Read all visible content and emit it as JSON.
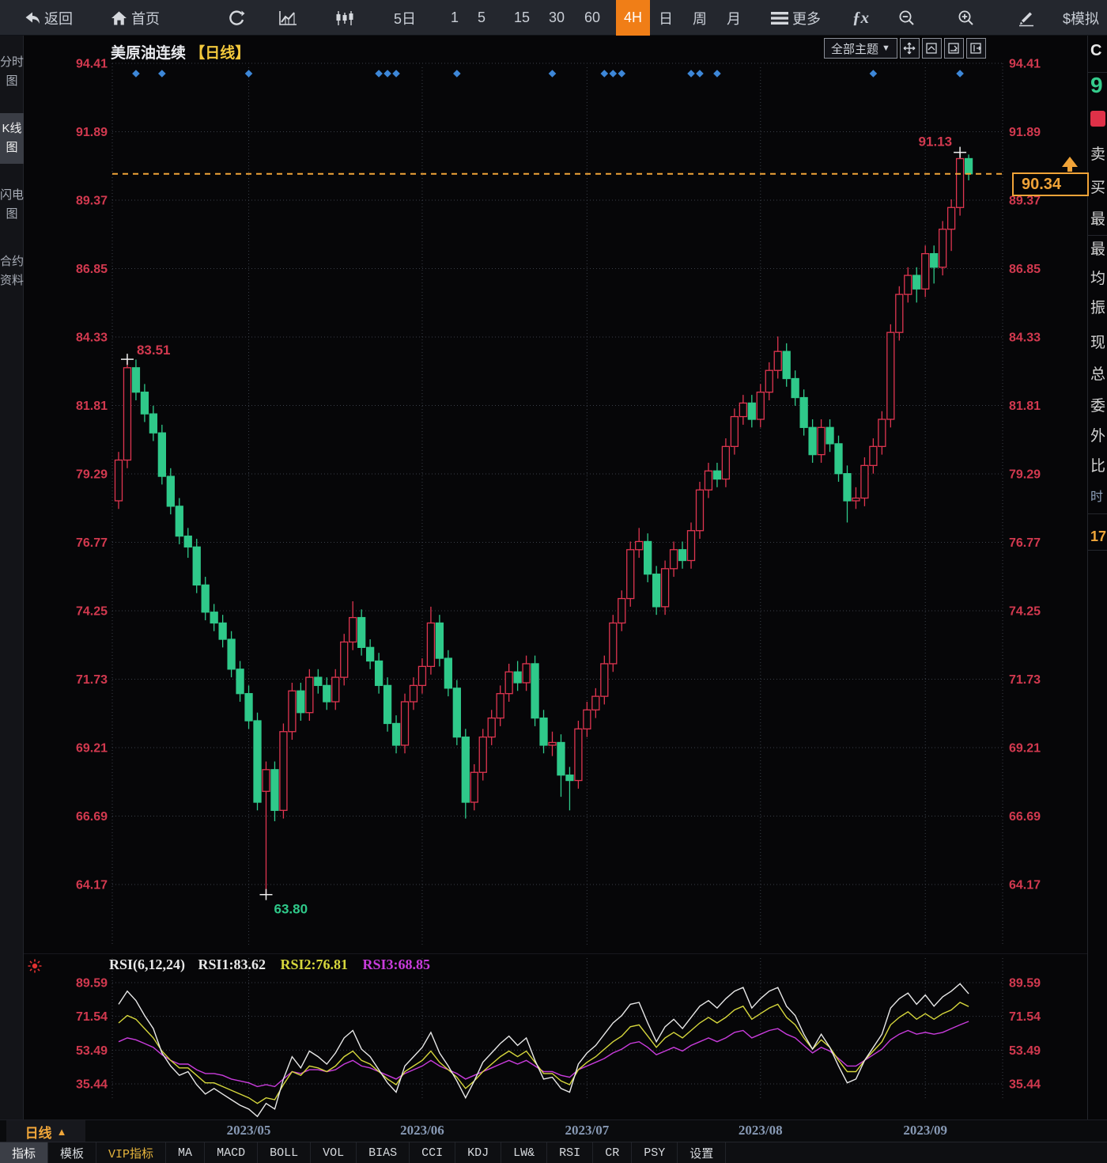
{
  "toolbar": {
    "items": [
      {
        "name": "back",
        "label": "返回",
        "icon": "back"
      },
      {
        "name": "home",
        "label": "首页",
        "icon": "home"
      },
      {
        "name": "refresh",
        "icon": "refresh"
      },
      {
        "name": "chart-line",
        "icon": "chartLine"
      },
      {
        "name": "chart-candle",
        "icon": "chartCandle"
      },
      {
        "name": "period-5d",
        "label": "5日"
      },
      {
        "name": "period-1",
        "label": "1"
      },
      {
        "name": "period-5",
        "label": "5"
      },
      {
        "name": "period-15",
        "label": "15"
      },
      {
        "name": "period-30",
        "label": "30"
      },
      {
        "name": "period-60",
        "label": "60"
      },
      {
        "name": "period-4h",
        "label": "4H",
        "active": true
      },
      {
        "name": "period-day",
        "label": "日"
      },
      {
        "name": "period-week",
        "label": "周"
      },
      {
        "name": "period-month",
        "label": "月"
      },
      {
        "name": "more",
        "label": "更多",
        "icon": "menu"
      },
      {
        "name": "fx",
        "label": "ƒx",
        "fx": true
      },
      {
        "name": "zoom-out",
        "icon": "zoomOut"
      },
      {
        "name": "zoom-in",
        "icon": "zoomIn"
      },
      {
        "name": "draw",
        "icon": "pencil"
      },
      {
        "name": "sim-trade",
        "label": "$模拟"
      }
    ]
  },
  "sidebar": {
    "tabs": [
      {
        "name": "tab-time-chart",
        "label": "分时图",
        "active": false
      },
      {
        "name": "tab-kline-chart",
        "label": "K线图",
        "active": true
      },
      {
        "name": "tab-flash-chart",
        "label": "闪电图",
        "active": false
      },
      {
        "name": "tab-contract-info",
        "label": "合约资料",
        "active": false
      }
    ]
  },
  "chart": {
    "title": "美原油连续",
    "title_suffix": "【日线】",
    "theme_button_label": "全部主题",
    "theme_button_arrow": "▼",
    "current_price": "90.34",
    "annotations": {
      "first_high": "83.51",
      "low": "63.80",
      "high": "91.13"
    },
    "y_axis_labels": [
      "94.41",
      "91.89",
      "89.37",
      "86.85",
      "84.33",
      "81.81",
      "79.29",
      "76.77",
      "74.25",
      "71.73",
      "69.21",
      "66.69",
      "64.17"
    ],
    "price_axis_max": 94.41,
    "price_axis_min": 64.17,
    "month_ticks": [
      {
        "index": 15,
        "label": "2023/05"
      },
      {
        "index": 35,
        "label": "2023/06"
      },
      {
        "index": 54,
        "label": "2023/07"
      },
      {
        "index": 74,
        "label": "2023/08"
      },
      {
        "index": 93,
        "label": "2023/09"
      }
    ],
    "event_dot_indices": [
      2,
      5,
      15,
      30,
      31,
      32,
      39,
      50,
      56,
      57,
      58,
      66,
      67,
      69,
      87,
      97
    ],
    "chart_data": {
      "type": "candlestick",
      "ohlc": [
        [
          78.3,
          80.1,
          78.0,
          79.8
        ],
        [
          79.8,
          83.51,
          79.5,
          83.2
        ],
        [
          83.2,
          83.5,
          82.0,
          82.3
        ],
        [
          82.3,
          82.6,
          81.2,
          81.5
        ],
        [
          81.5,
          81.8,
          80.5,
          80.8
        ],
        [
          80.8,
          81.1,
          78.9,
          79.2
        ],
        [
          79.2,
          79.5,
          77.8,
          78.1
        ],
        [
          78.1,
          78.4,
          76.7,
          77.0
        ],
        [
          77.0,
          77.3,
          76.2,
          76.6
        ],
        [
          76.6,
          76.9,
          74.9,
          75.2
        ],
        [
          75.2,
          75.5,
          73.9,
          74.2
        ],
        [
          74.2,
          74.5,
          73.5,
          73.8
        ],
        [
          73.8,
          74.1,
          72.9,
          73.2
        ],
        [
          73.2,
          73.5,
          71.8,
          72.1
        ],
        [
          72.1,
          72.4,
          70.9,
          71.2
        ],
        [
          71.2,
          71.5,
          69.9,
          70.2
        ],
        [
          70.2,
          70.5,
          66.9,
          67.2
        ],
        [
          67.6,
          68.7,
          63.8,
          68.4
        ],
        [
          68.4,
          68.7,
          66.5,
          66.9
        ],
        [
          66.9,
          70.1,
          66.6,
          69.8
        ],
        [
          69.8,
          71.6,
          69.5,
          71.3
        ],
        [
          71.3,
          71.6,
          70.2,
          70.5
        ],
        [
          70.5,
          72.1,
          70.2,
          71.8
        ],
        [
          71.8,
          72.1,
          71.2,
          71.5
        ],
        [
          71.5,
          71.8,
          70.6,
          70.9
        ],
        [
          70.9,
          72.1,
          70.6,
          71.8
        ],
        [
          71.8,
          73.4,
          71.5,
          73.1
        ],
        [
          73.1,
          74.6,
          72.8,
          74.0
        ],
        [
          74.0,
          74.3,
          72.6,
          72.9
        ],
        [
          72.9,
          73.2,
          72.1,
          72.4
        ],
        [
          72.4,
          72.7,
          71.2,
          71.5
        ],
        [
          71.5,
          71.8,
          69.8,
          70.1
        ],
        [
          70.1,
          70.4,
          69.0,
          69.3
        ],
        [
          69.3,
          71.2,
          69.0,
          70.9
        ],
        [
          70.9,
          71.8,
          70.6,
          71.5
        ],
        [
          71.5,
          72.5,
          71.2,
          72.2
        ],
        [
          72.2,
          74.4,
          71.9,
          73.8
        ],
        [
          73.8,
          74.1,
          72.2,
          72.5
        ],
        [
          72.5,
          72.8,
          71.1,
          71.4
        ],
        [
          71.4,
          71.7,
          69.3,
          69.6
        ],
        [
          69.6,
          69.9,
          66.6,
          67.2
        ],
        [
          67.2,
          68.6,
          66.9,
          68.3
        ],
        [
          68.3,
          69.9,
          68.0,
          69.6
        ],
        [
          69.6,
          70.6,
          69.3,
          70.3
        ],
        [
          70.3,
          71.5,
          70.0,
          71.2
        ],
        [
          71.2,
          72.3,
          70.9,
          72.0
        ],
        [
          72.0,
          72.4,
          71.3,
          71.6
        ],
        [
          71.6,
          72.6,
          71.3,
          72.3
        ],
        [
          72.3,
          72.6,
          70.0,
          70.3
        ],
        [
          70.3,
          70.6,
          69.0,
          69.3
        ],
        [
          69.3,
          69.8,
          68.9,
          69.4
        ],
        [
          69.4,
          69.7,
          67.4,
          68.2
        ],
        [
          68.2,
          68.5,
          66.9,
          68.0
        ],
        [
          68.0,
          70.2,
          67.7,
          69.9
        ],
        [
          69.9,
          70.9,
          69.6,
          70.6
        ],
        [
          70.6,
          71.4,
          70.3,
          71.1
        ],
        [
          71.1,
          72.6,
          70.8,
          72.3
        ],
        [
          72.3,
          74.1,
          72.0,
          73.8
        ],
        [
          73.8,
          75.0,
          73.5,
          74.7
        ],
        [
          74.7,
          76.8,
          74.4,
          76.5
        ],
        [
          76.5,
          77.3,
          76.2,
          76.8
        ],
        [
          76.8,
          77.1,
          75.3,
          75.6
        ],
        [
          75.6,
          75.9,
          74.1,
          74.4
        ],
        [
          74.4,
          76.1,
          74.1,
          75.8
        ],
        [
          75.8,
          76.8,
          75.5,
          76.5
        ],
        [
          76.5,
          76.8,
          75.8,
          76.1
        ],
        [
          76.1,
          77.5,
          75.8,
          77.2
        ],
        [
          77.2,
          79.0,
          76.9,
          78.7
        ],
        [
          78.7,
          79.7,
          78.4,
          79.4
        ],
        [
          79.4,
          79.7,
          78.8,
          79.1
        ],
        [
          79.1,
          80.6,
          78.8,
          80.3
        ],
        [
          80.3,
          81.7,
          80.0,
          81.4
        ],
        [
          81.4,
          82.2,
          81.1,
          81.9
        ],
        [
          81.9,
          82.2,
          81.0,
          81.3
        ],
        [
          81.3,
          82.6,
          81.0,
          82.3
        ],
        [
          82.3,
          83.4,
          82.0,
          83.1
        ],
        [
          83.1,
          84.35,
          82.8,
          83.8
        ],
        [
          83.8,
          84.1,
          82.5,
          82.8
        ],
        [
          82.8,
          83.1,
          81.8,
          82.1
        ],
        [
          82.1,
          82.4,
          80.7,
          81.0
        ],
        [
          81.0,
          81.3,
          79.7,
          80.0
        ],
        [
          80.0,
          81.3,
          79.7,
          81.0
        ],
        [
          81.0,
          81.3,
          80.1,
          80.4
        ],
        [
          80.4,
          80.7,
          79.0,
          79.3
        ],
        [
          79.3,
          79.6,
          77.5,
          78.3
        ],
        [
          78.3,
          78.8,
          78.0,
          78.4
        ],
        [
          78.4,
          79.9,
          78.1,
          79.6
        ],
        [
          79.6,
          80.6,
          79.3,
          80.3
        ],
        [
          80.3,
          81.6,
          80.0,
          81.3
        ],
        [
          81.3,
          84.8,
          81.0,
          84.5
        ],
        [
          84.5,
          86.2,
          84.2,
          85.9
        ],
        [
          85.9,
          86.9,
          85.6,
          86.6
        ],
        [
          86.6,
          86.9,
          85.6,
          86.1
        ],
        [
          86.1,
          87.7,
          85.8,
          87.4
        ],
        [
          87.4,
          87.7,
          86.3,
          86.9
        ],
        [
          86.9,
          88.6,
          86.6,
          88.3
        ],
        [
          88.3,
          89.4,
          87.5,
          89.1
        ],
        [
          89.1,
          91.13,
          88.8,
          90.9
        ],
        [
          90.9,
          91.05,
          90.1,
          90.34
        ]
      ]
    }
  },
  "rsi": {
    "param_label": "RSI(6,12,24)",
    "rsi1_label": "RSI1:83.62",
    "rsi2_label": "RSI2:76.81",
    "rsi3_label": "RSI3:68.85",
    "y_axis_labels": [
      "89.59",
      "71.54",
      "53.49",
      "35.44"
    ],
    "axis_max": 89.59,
    "axis_min": 35.44,
    "chart_data": {
      "type": "line",
      "series": [
        {
          "name": "RSI1",
          "color": "#e8e8e8",
          "values": [
            78,
            85,
            80,
            72,
            65,
            52,
            45,
            40,
            42,
            35,
            30,
            33,
            30,
            27,
            24,
            22,
            18,
            25,
            22,
            38,
            50,
            44,
            53,
            50,
            46,
            52,
            60,
            64,
            54,
            50,
            43,
            36,
            31,
            45,
            50,
            55,
            63,
            52,
            45,
            37,
            28,
            37,
            47,
            52,
            57,
            61,
            56,
            60,
            48,
            38,
            39,
            33,
            31,
            46,
            52,
            56,
            62,
            68,
            72,
            78,
            79,
            68,
            58,
            66,
            70,
            65,
            71,
            77,
            80,
            76,
            81,
            85,
            87,
            76,
            81,
            85,
            87,
            77,
            72,
            62,
            54,
            62,
            55,
            45,
            36,
            38,
            48,
            55,
            62,
            76,
            81,
            84,
            78,
            83,
            77,
            82,
            85,
            89,
            83.62
          ]
        },
        {
          "name": "RSI2",
          "color": "#d6d73c",
          "values": [
            68,
            72,
            70,
            65,
            60,
            53,
            48,
            44,
            44,
            40,
            36,
            36,
            34,
            32,
            30,
            28,
            25,
            28,
            27,
            35,
            42,
            40,
            45,
            44,
            42,
            45,
            50,
            53,
            48,
            46,
            42,
            38,
            35,
            42,
            45,
            48,
            53,
            47,
            43,
            39,
            33,
            37,
            42,
            46,
            50,
            53,
            50,
            53,
            47,
            41,
            41,
            37,
            35,
            43,
            47,
            50,
            54,
            58,
            61,
            66,
            67,
            61,
            55,
            60,
            63,
            60,
            64,
            68,
            71,
            68,
            71,
            75,
            77,
            70,
            73,
            76,
            78,
            71,
            67,
            60,
            54,
            59,
            55,
            48,
            42,
            42,
            48,
            53,
            58,
            67,
            71,
            74,
            70,
            73,
            70,
            73,
            75,
            79,
            76.81
          ]
        },
        {
          "name": "RSI3",
          "color": "#c93cdc",
          "values": [
            58,
            60,
            59,
            57,
            55,
            51,
            48,
            46,
            46,
            43,
            41,
            41,
            40,
            38,
            37,
            36,
            34,
            35,
            34,
            38,
            42,
            41,
            43,
            43,
            42,
            43,
            46,
            48,
            45,
            44,
            42,
            40,
            38,
            41,
            43,
            45,
            48,
            45,
            43,
            41,
            38,
            40,
            42,
            44,
            46,
            48,
            46,
            48,
            45,
            42,
            42,
            40,
            39,
            43,
            45,
            47,
            49,
            52,
            54,
            57,
            58,
            55,
            51,
            53,
            55,
            53,
            56,
            58,
            60,
            58,
            60,
            63,
            64,
            60,
            62,
            64,
            65,
            62,
            60,
            56,
            52,
            55,
            53,
            49,
            45,
            45,
            48,
            51,
            54,
            59,
            62,
            64,
            62,
            63,
            62,
            63,
            65,
            67,
            68.85
          ]
        }
      ]
    }
  },
  "x_axis": {
    "period_label": "日线",
    "period_arrow": "▲"
  },
  "bottom_tabs": [
    {
      "name": "tab-indicator",
      "label": "指标",
      "active": true
    },
    {
      "name": "tab-template",
      "label": "模板"
    },
    {
      "name": "tab-vip-indicator",
      "label": "VIP指标",
      "vip": true
    },
    {
      "name": "tab-ma",
      "label": "MA"
    },
    {
      "name": "tab-macd",
      "label": "MACD"
    },
    {
      "name": "tab-boll",
      "label": "BOLL"
    },
    {
      "name": "tab-vol",
      "label": "VOL"
    },
    {
      "name": "tab-bias",
      "label": "BIAS"
    },
    {
      "name": "tab-cci",
      "label": "CCI"
    },
    {
      "name": "tab-kdj",
      "label": "KDJ"
    },
    {
      "name": "tab-lw",
      "label": "LW&"
    },
    {
      "name": "tab-rsi",
      "label": "RSI"
    },
    {
      "name": "tab-cr",
      "label": "CR"
    },
    {
      "name": "tab-psy",
      "label": "PSY"
    },
    {
      "name": "tab-settings",
      "label": "设置"
    }
  ],
  "right_panel": {
    "items": [
      {
        "text": "C",
        "style": "sym"
      },
      {
        "text": "9",
        "style": "price"
      },
      {
        "text": "",
        "style": "badge"
      },
      {
        "text": "卖",
        "style": "label"
      },
      {
        "text": "买",
        "style": "label"
      },
      {
        "text": "最",
        "style": "label"
      },
      {
        "text": "最",
        "style": "label"
      },
      {
        "text": "均",
        "style": "label"
      },
      {
        "text": "振",
        "style": "label"
      },
      {
        "text": "现",
        "style": "label"
      },
      {
        "text": "总",
        "style": "label"
      },
      {
        "text": "委",
        "style": "label"
      },
      {
        "text": "外",
        "style": "label"
      },
      {
        "text": "比",
        "style": "label"
      },
      {
        "text": "时",
        "style": "time"
      },
      {
        "text": "17",
        "style": "num"
      }
    ]
  },
  "colors": {
    "up": "#df3550",
    "down": "#2fc98a",
    "axis_text": "#d2394f",
    "accent_orange": "#f0a338",
    "active_period_bg": "#f07e17",
    "event_dot": "#3d87d8",
    "grid": "#3a3f48",
    "month_text": "#8799b4"
  }
}
